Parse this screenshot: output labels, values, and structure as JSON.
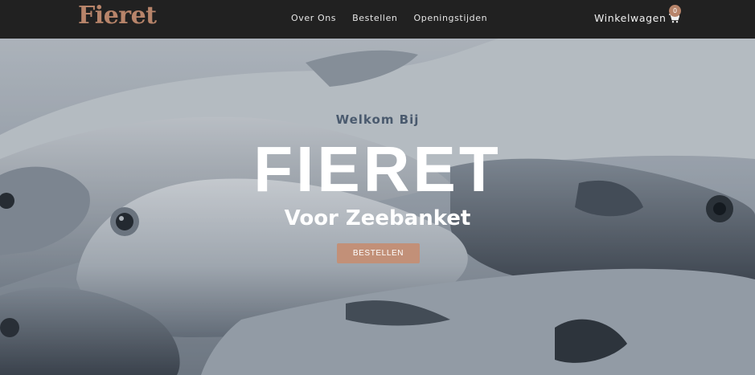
{
  "brand_colors": {
    "accent": "#b7846a",
    "navbar": "#212121",
    "button": "#c29078"
  },
  "navbar": {
    "logo": "Fieret",
    "links": [
      "Over Ons",
      "Bestellen",
      "Openingstijden"
    ],
    "cart": {
      "label": "Winkelwagen",
      "icon": "shopping-cart-icon",
      "count": "0"
    }
  },
  "hero": {
    "welcome": "Welkom Bij",
    "brand": "FIERET",
    "tagline": "Voor Zeebanket",
    "button": "BESTELLEN"
  }
}
